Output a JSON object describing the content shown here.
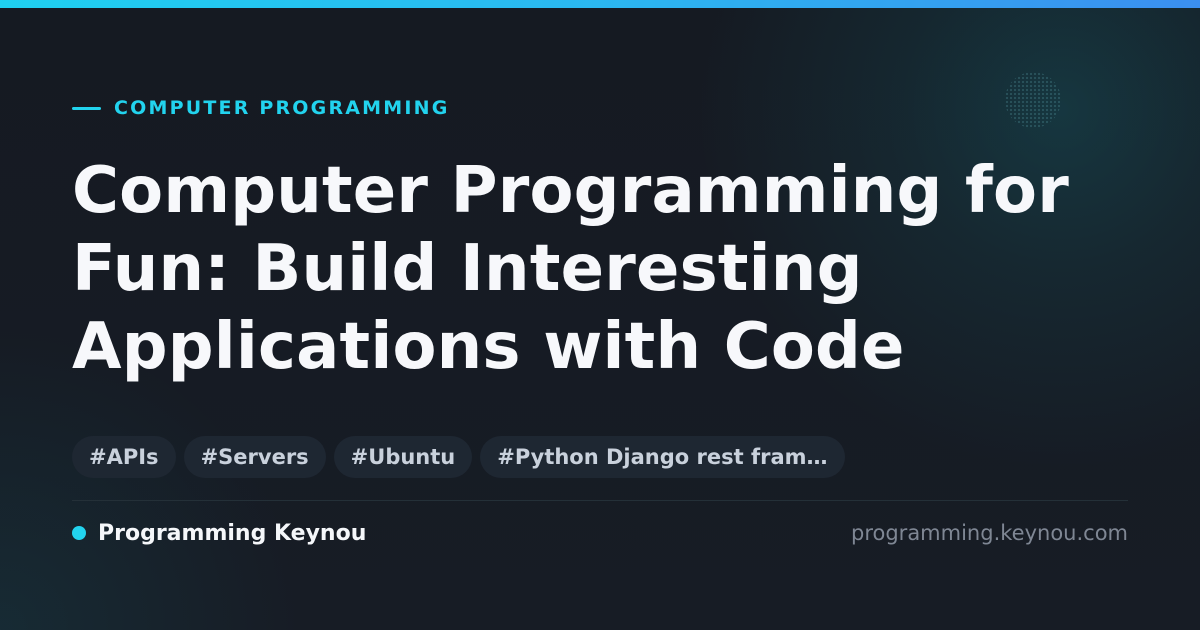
{
  "category": "COMPUTER PROGRAMMING",
  "title_lines": [
    "Computer Programming for",
    "Fun: Build Interesting",
    "Applications with Code"
  ],
  "tags": [
    "#APIs",
    "#Servers",
    "#Ubuntu",
    "#Python Django rest fram…"
  ],
  "brand": {
    "name": "Programming Keynou",
    "url": "programming.keynou.com"
  },
  "colors": {
    "accent": "#22d3ee",
    "background": "#161b23",
    "title": "#f7f8fb",
    "tag_background": "#1e2732",
    "muted_text": "#7f8794"
  }
}
